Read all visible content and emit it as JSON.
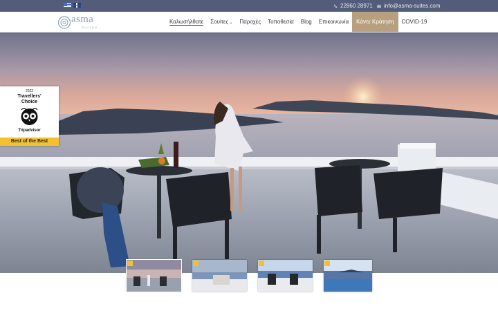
{
  "topbar": {
    "languages": [
      {
        "name": "greek-flag-icon"
      },
      {
        "name": "uk-flag-icon"
      }
    ],
    "phone": "22860 28971",
    "email": "info@asma-suites.com"
  },
  "header": {
    "logo_text": "asma",
    "logo_subtitle": "SUITES",
    "nav": [
      {
        "label": "Καλωσήλθατε",
        "active": true
      },
      {
        "label": "Σουίτες",
        "has_dropdown": true
      },
      {
        "label": "Παροχές"
      },
      {
        "label": "Τοποθεσία"
      },
      {
        "label": "Blog"
      },
      {
        "label": "Επικοινωνία"
      },
      {
        "label": "Κάντε Κράτηση",
        "highlighted": true
      },
      {
        "label": "COVID-19"
      }
    ]
  },
  "badge": {
    "year": "2022",
    "line1": "Travellers'",
    "line2": "Choice",
    "brand": "Tripadvisor",
    "ribbon": "Best of the Best"
  },
  "colors": {
    "topbar_bg": "#535c7a",
    "book_button_bg": "#b8a07e",
    "badge_ribbon": "#f2c12e",
    "logo": "#8aa0b6"
  },
  "gallery": {
    "thumbnail_count": 4,
    "active_index": 0
  }
}
